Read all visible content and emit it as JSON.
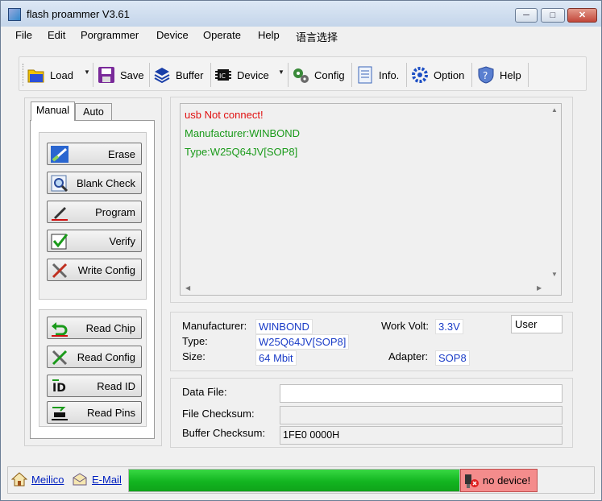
{
  "window": {
    "title": "flash proammer V3.61",
    "controls": [
      "─",
      "□",
      "✕"
    ]
  },
  "menu": [
    "File",
    "Edit",
    "Porgrammer",
    "Device",
    "Operate",
    "Help",
    "语言选择"
  ],
  "toolbar": {
    "load": "Load",
    "save": "Save",
    "buffer": "Buffer",
    "device": "Device",
    "config": "Config",
    "info": "Info.",
    "option": "Option",
    "help": "Help"
  },
  "tabs": {
    "manual": "Manual",
    "auto": "Auto"
  },
  "buttons": {
    "erase": "Erase",
    "blank_check": "Blank Check",
    "program": "Program",
    "verify": "Verify",
    "write_config": "Write Config",
    "read_chip": "Read Chip",
    "read_config": "Read Config",
    "read_id": "Read ID",
    "read_pins": "Read Pins"
  },
  "log": {
    "lines": [
      "usb Not connect!",
      "Manufacturer:WINBOND",
      "Type:W25Q64JV[SOP8]"
    ],
    "colors": [
      "#e01010",
      "#1a9a1a",
      "#1a9a1a"
    ]
  },
  "chip_info": {
    "manufacturer_label": "Manufacturer:",
    "manufacturer": "WINBOND",
    "type_label": "Type:",
    "type": "W25Q64JV[SOP8]",
    "size_label": "Size:",
    "size": "64 Mbit",
    "work_volt_label": "Work Volt:",
    "work_volt": "3.3V",
    "adapter_label": "Adapter:",
    "adapter": "SOP8",
    "user": "User"
  },
  "files": {
    "data_file_label": "Data File:",
    "data_file": "",
    "file_checksum_label": "File Checksum:",
    "file_checksum": "",
    "buffer_checksum_label": "Buffer Checksum:",
    "buffer_checksum": "1FE0 0000H"
  },
  "status": {
    "link1": "Meilico",
    "link2": "E-Mail",
    "progress": 1.0,
    "device": "no device!"
  }
}
